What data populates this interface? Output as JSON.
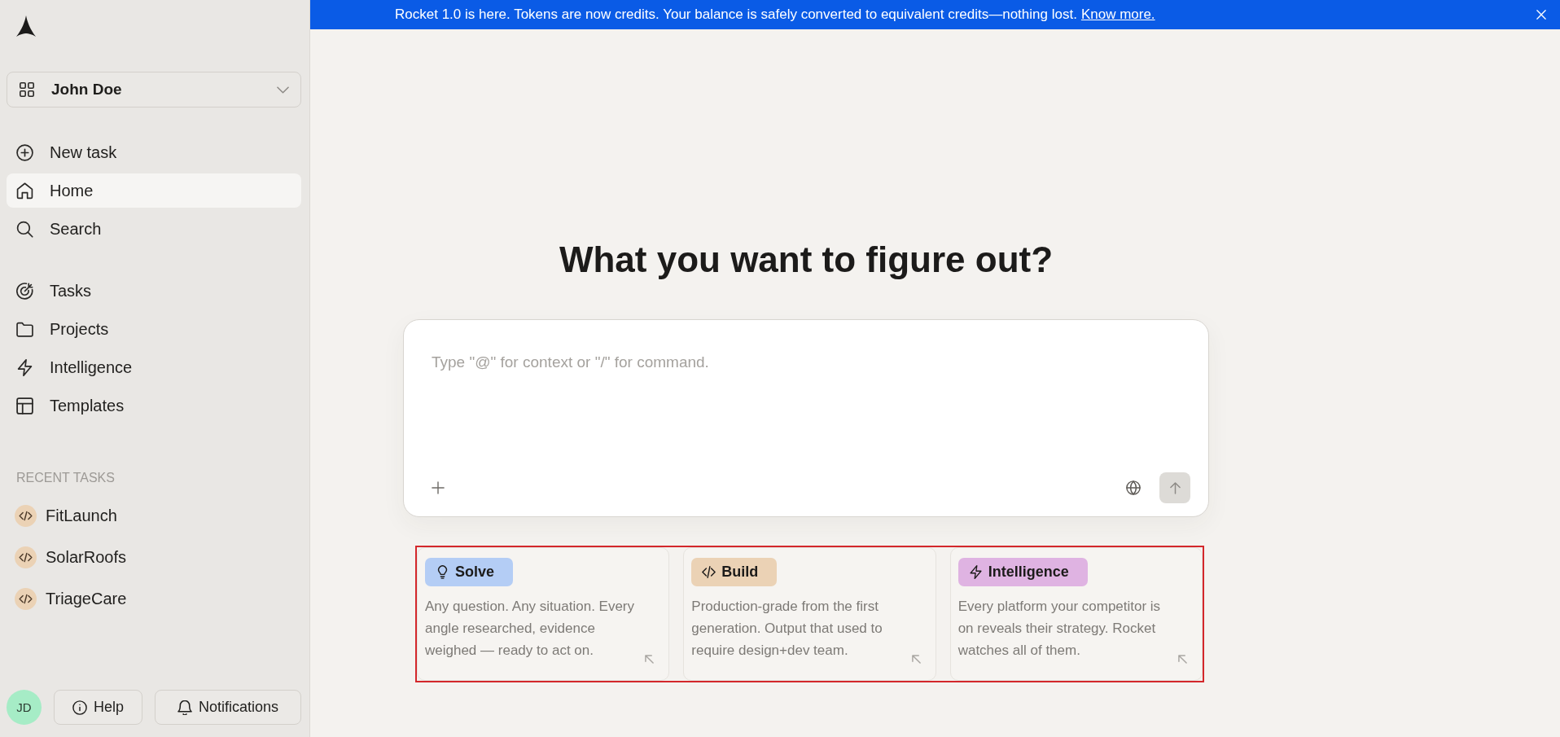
{
  "banner": {
    "message": "Rocket 1.0 is here. Tokens are now credits. Your balance is safely converted to equivalent credits—nothing lost.",
    "link": "Know more."
  },
  "sidebar": {
    "account": {
      "name": "John Doe"
    },
    "nav_main": [
      {
        "label": "New task",
        "selected": false
      },
      {
        "label": "Home",
        "selected": true
      },
      {
        "label": "Search",
        "selected": false
      }
    ],
    "nav_sections": [
      {
        "label": "Tasks",
        "selected": false
      },
      {
        "label": "Projects",
        "selected": false
      },
      {
        "label": "Intelligence",
        "selected": false
      },
      {
        "label": "Templates",
        "selected": false
      }
    ],
    "recent_tasks": {
      "title": "RECENT TASKS",
      "items": [
        {
          "label": "FitLaunch",
          "selected": false
        },
        {
          "label": "SolarRoofs",
          "selected": false
        },
        {
          "label": "TriageCare",
          "selected": false
        }
      ]
    },
    "footer": {
      "avatar": "JD",
      "buttons": [
        {
          "label": "Help"
        },
        {
          "label": "Notifications"
        }
      ]
    }
  },
  "main": {
    "heading": "What you want to figure out?",
    "composer": {
      "placeholder": "Type \"@\" for context or \"/\" for command.",
      "send_disabled": true
    },
    "modes": {
      "highlighted": true,
      "items": [
        {
          "label": "Solve",
          "color": "#b4cdf5",
          "description": "Any question. Any situation. Every angle researched, evidence weighed — ready to act on."
        },
        {
          "label": "Build",
          "color": "#ebd2b5",
          "description": "Production-grade from the first generation. Output that used to require design+dev team."
        },
        {
          "label": "Intelligence",
          "color": "#dfb3e2",
          "description": "Every platform your competitor is on reveals their strategy. Rocket watches all of them."
        }
      ]
    }
  }
}
